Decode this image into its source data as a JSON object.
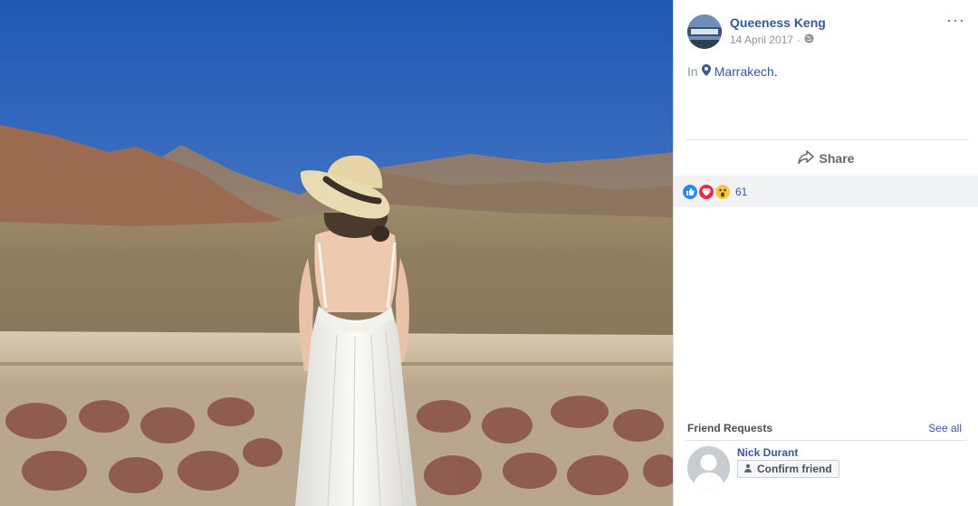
{
  "post": {
    "author": "Queeness Keng",
    "date": "14 April 2017",
    "separator": "·",
    "privacy_icon": "globe-icon",
    "location_prefix": "In",
    "location": "Marrakech",
    "location_suffix": ".",
    "more_label": "···"
  },
  "actions": {
    "share_label": "Share"
  },
  "reactions": {
    "icons": [
      "like-icon",
      "love-icon",
      "wow-icon"
    ],
    "count": "61"
  },
  "friend_requests": {
    "title": "Friend Requests",
    "see_all": "See all",
    "items": [
      {
        "name": "Nick Durant",
        "confirm_label": "Confirm friend"
      }
    ]
  },
  "colors": {
    "link": "#365899",
    "like": "#2d88ff",
    "love": "#f0284a",
    "wow": "#fcc643",
    "sky": "#2c63be"
  }
}
